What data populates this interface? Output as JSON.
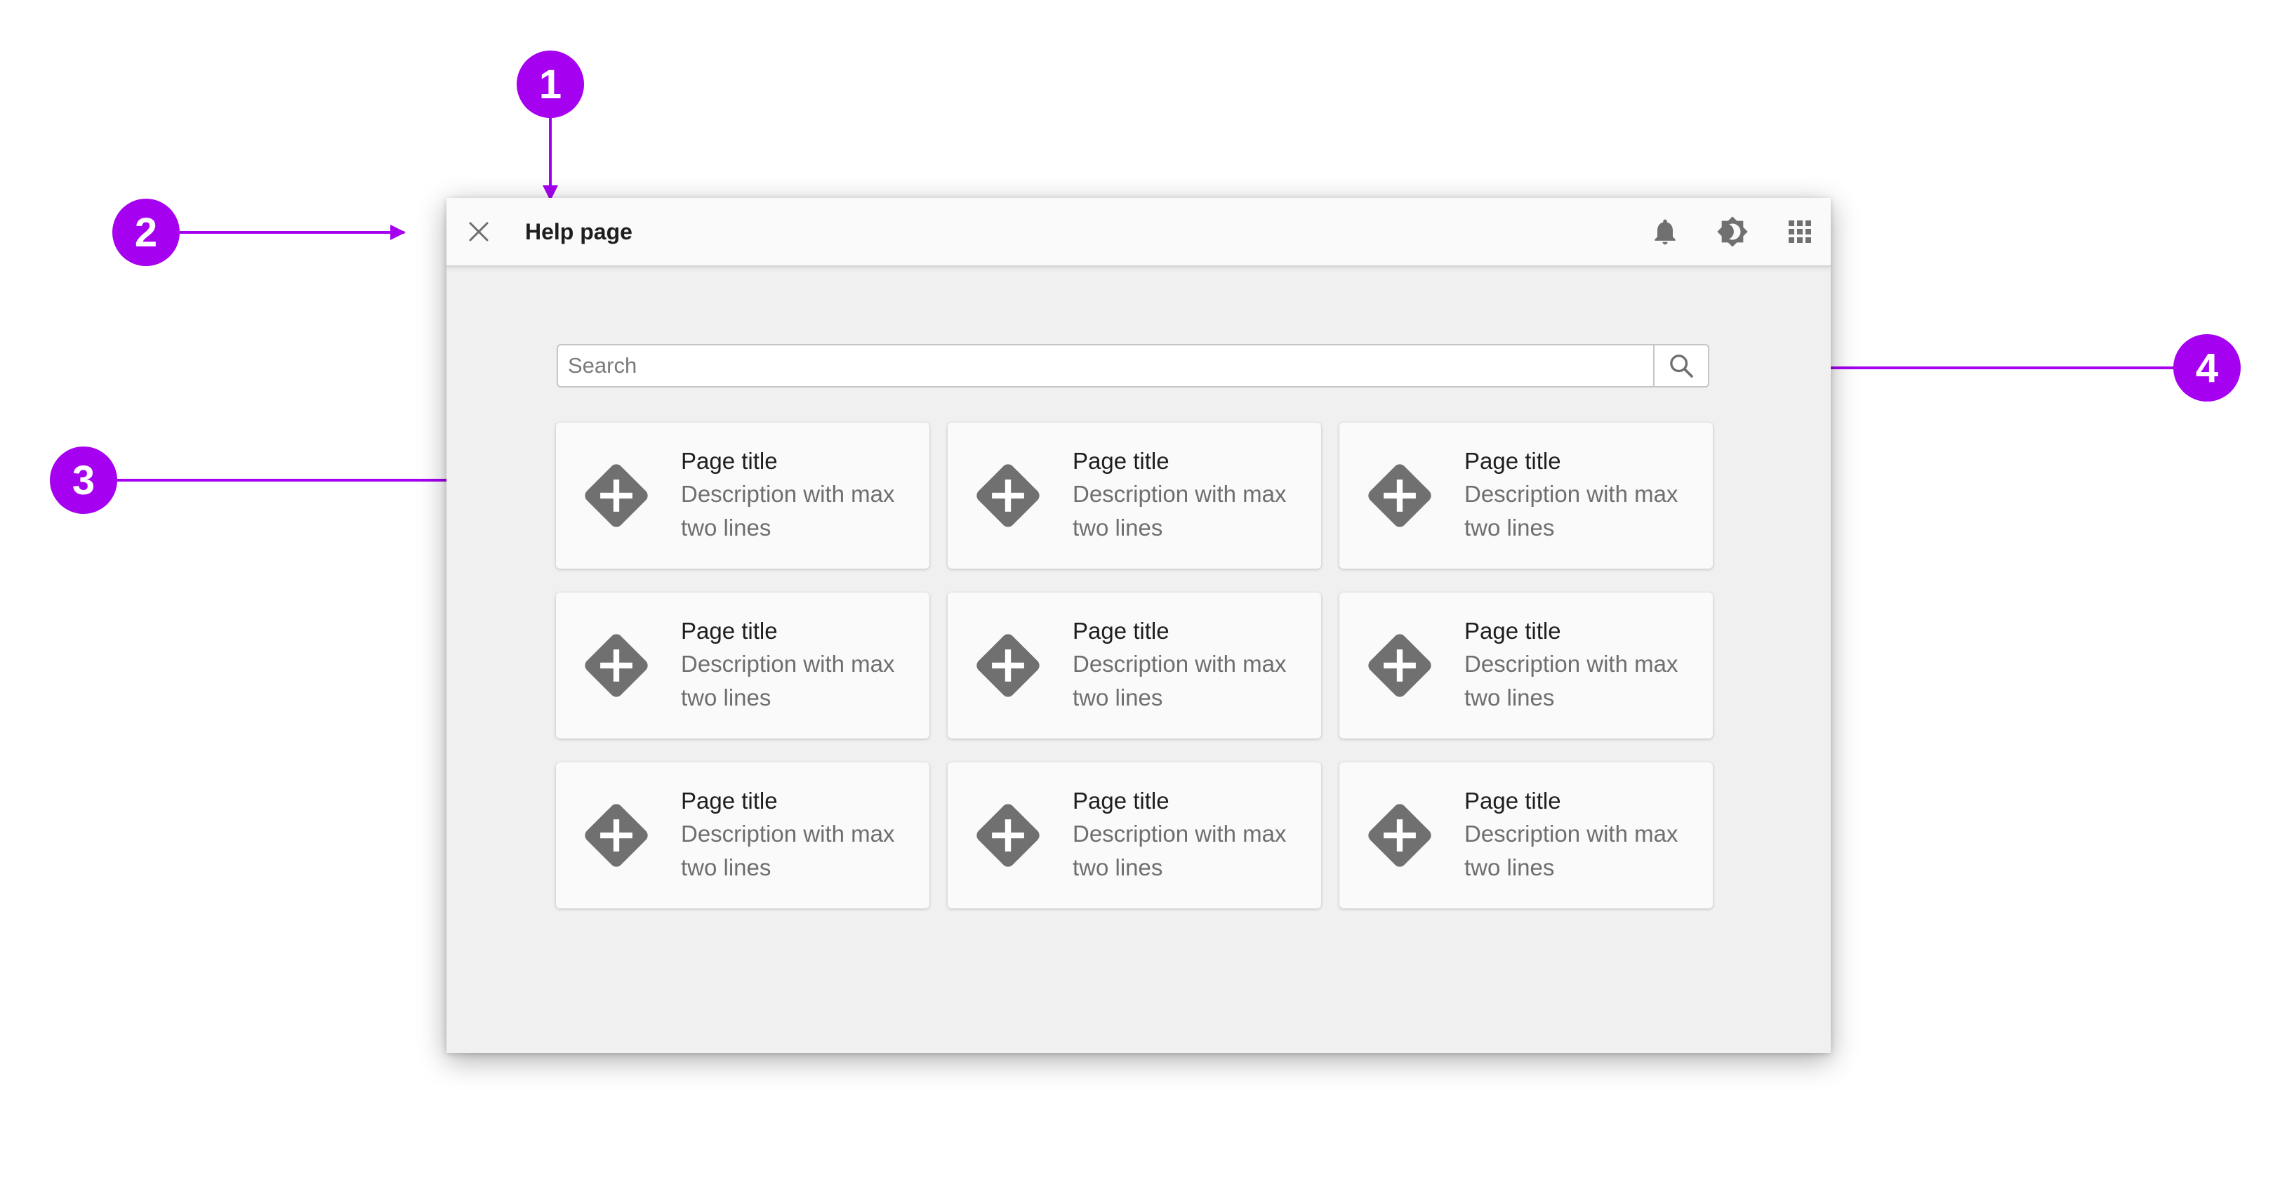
{
  "callouts": [
    "1",
    "2",
    "3",
    "4"
  ],
  "appbar": {
    "title": "Help page",
    "close_icon": "close-icon",
    "actions": [
      {
        "icon": "bell-icon"
      },
      {
        "icon": "brightness-icon"
      },
      {
        "icon": "apps-grid-icon"
      }
    ]
  },
  "search": {
    "placeholder": "Search",
    "value": "",
    "icon": "search-icon"
  },
  "tiles": [
    {
      "title": "Page title",
      "description": "Description with max two lines",
      "icon": "add-diamond-icon"
    },
    {
      "title": "Page title",
      "description": "Description with max two lines",
      "icon": "add-diamond-icon"
    },
    {
      "title": "Page title",
      "description": "Description with max two lines",
      "icon": "add-diamond-icon"
    },
    {
      "title": "Page title",
      "description": "Description with max two lines",
      "icon": "add-diamond-icon"
    },
    {
      "title": "Page title",
      "description": "Description with max two lines",
      "icon": "add-diamond-icon"
    },
    {
      "title": "Page title",
      "description": "Description with max two lines",
      "icon": "add-diamond-icon"
    },
    {
      "title": "Page title",
      "description": "Description with max two lines",
      "icon": "add-diamond-icon"
    },
    {
      "title": "Page title",
      "description": "Description with max two lines",
      "icon": "add-diamond-icon"
    },
    {
      "title": "Page title",
      "description": "Description with max two lines",
      "icon": "add-diamond-icon"
    }
  ],
  "colors": {
    "annotation": "#a500f0",
    "icon": "#707070",
    "surface": "#fafafa",
    "background": "#f0f0f0"
  }
}
